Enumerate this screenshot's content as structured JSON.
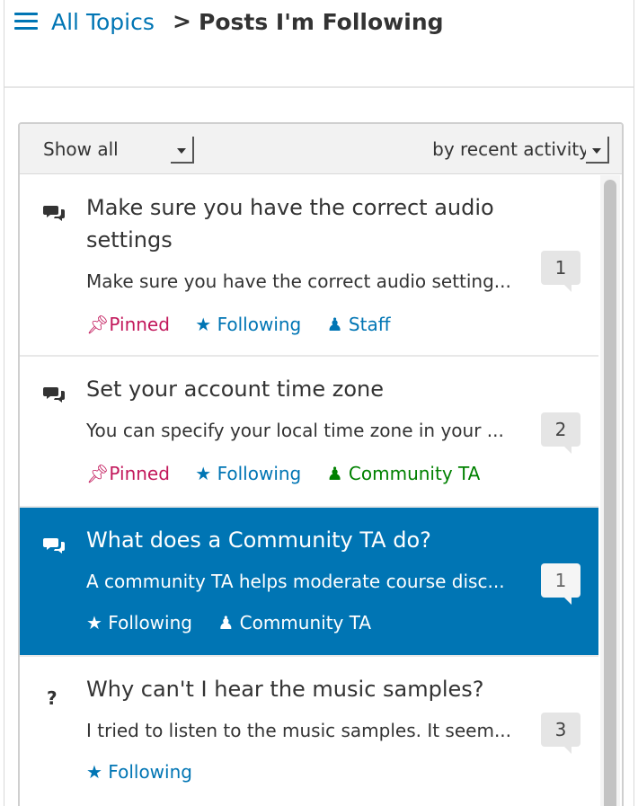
{
  "breadcrumb": {
    "all_topics": "All Topics",
    "separator": ">",
    "current": "Posts I'm Following"
  },
  "filters": {
    "show": "Show all",
    "sort": "by recent activity"
  },
  "posts": [
    {
      "type_icon": "comments-icon",
      "title": "Make sure you have the correct audio settings",
      "snippet": "Make sure you have the correct audio setting...",
      "count": "1",
      "tags": {
        "pinned": "Pinned",
        "following": "Following",
        "role": "Staff"
      }
    },
    {
      "type_icon": "comments-icon",
      "title": "Set your account time zone",
      "snippet": "You can specify your local time zone in your ...",
      "count": "2",
      "tags": {
        "pinned": "Pinned",
        "following": "Following",
        "role": "Community TA"
      }
    },
    {
      "type_icon": "comments-icon",
      "title": "What does a Community TA do?",
      "snippet": "A community TA helps moderate course disc...",
      "count": "1",
      "selected": true,
      "tags": {
        "following": "Following",
        "role": "Community TA"
      }
    },
    {
      "type_icon": "question-icon",
      "title": "Why can't I hear the music samples?",
      "snippet": "I tried to listen to the music samples. It seem...",
      "count": "3",
      "tags": {
        "following": "Following"
      }
    }
  ],
  "colors": {
    "accent": "#0075b4",
    "pinned": "#c2185b",
    "community_ta": "#008100",
    "selected_bg": "#0075b4"
  }
}
